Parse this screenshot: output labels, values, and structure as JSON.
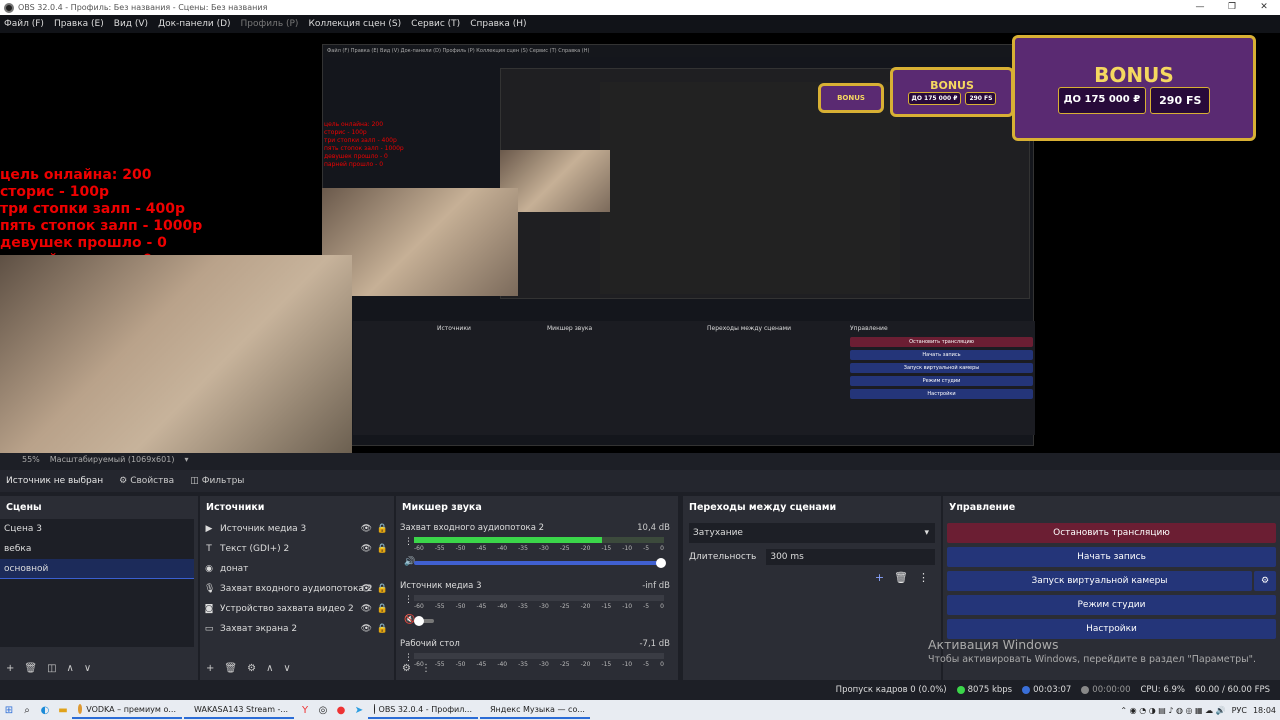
{
  "window": {
    "title": "OBS 32.0.4 - Профиль: Без названия - Сцены: Без названия",
    "minimize": "—",
    "maximize": "❐",
    "close": "✕"
  },
  "menu": [
    "Файл (F)",
    "Правка (E)",
    "Вид (V)",
    "Док-панели (D)",
    "Профиль (P)",
    "Коллекция сцен (S)",
    "Сервис (T)",
    "Справка (H)"
  ],
  "preview": {
    "red_lines": [
      "цель онлайна: 200",
      "сторис - 100р",
      "три стопки залп - 400р",
      "пять стопок залп - 1000р",
      "девушек прошло - 0",
      "парней прошло - 0"
    ],
    "bonus": {
      "title": "BONUS",
      "left": "ДО 175 000 ₽",
      "right": "290 FS"
    }
  },
  "preview_bar": {
    "zoom": "55%",
    "scale": "Масштабируемый (1069x601)"
  },
  "source_bar": {
    "status": "Источник не выбран",
    "properties": "Свойства",
    "filters": "Фильтры"
  },
  "scenes": {
    "title": "Сцены",
    "items": [
      "Сцена 3",
      "вебка",
      "основной"
    ]
  },
  "sources": {
    "title": "Источники",
    "items": [
      {
        "label": "Источник медиа 3",
        "icon": "play-icon"
      },
      {
        "label": "Текст (GDI+) 2",
        "icon": "text-icon"
      },
      {
        "label": "донат",
        "icon": "globe-icon"
      },
      {
        "label": "Захват входного аудиопотока 2",
        "icon": "mic-icon"
      },
      {
        "label": "Устройство захвата видео 2",
        "icon": "camera-icon"
      },
      {
        "label": "Захват экрана 2",
        "icon": "monitor-icon"
      }
    ]
  },
  "mixer": {
    "title": "Микшер звука",
    "ticks": [
      "-60",
      "-55",
      "-50",
      "-45",
      "-40",
      "-35",
      "-30",
      "-25",
      "-20",
      "-15",
      "-10",
      "-5",
      "0"
    ],
    "channels": [
      {
        "name": "Захват входного аудиопотока 2",
        "db": "10,4 dB",
        "level": 0.75
      },
      {
        "name": "Источник медиа 3",
        "db": "-inf dB",
        "level": 0.0
      },
      {
        "name": "Рабочий стол",
        "db": "-7,1 dB",
        "level": 0.0
      }
    ]
  },
  "transitions": {
    "title": "Переходы между сценами",
    "selected": "Затухание",
    "duration_label": "Длительность",
    "duration": "300 ms"
  },
  "controls": {
    "title": "Управление",
    "buttons": [
      "Остановить трансляцию",
      "Начать запись",
      "Запуск виртуальной камеры",
      "Режим студии",
      "Настройки"
    ]
  },
  "watermark": {
    "line1": "Активация Windows",
    "line2": "Чтобы активировать Windows, перейдите в раздел \"Параметры\"."
  },
  "status": {
    "dropped": "Пропуск кадров 0 (0.0%)",
    "bitrate": "8075 kbps",
    "stream_time": "00:03:07",
    "rec_time": "00:00:00",
    "cpu": "CPU: 6.9%",
    "fps": "60.00 / 60.00 FPS"
  },
  "taskbar": {
    "apps": [
      "VODKA – премиум о...",
      "WAKASA143 Stream -...",
      "OBS 32.0.4 - Профил...",
      "Яндекс Музыка — со..."
    ],
    "lang": "РУС",
    "time": "18:04"
  },
  "colors": {
    "stop_stream": "#6b1e33",
    "control_blue": "#243579",
    "meter_green": "#3bd64a",
    "selected_scene": "#1c2b5a"
  }
}
